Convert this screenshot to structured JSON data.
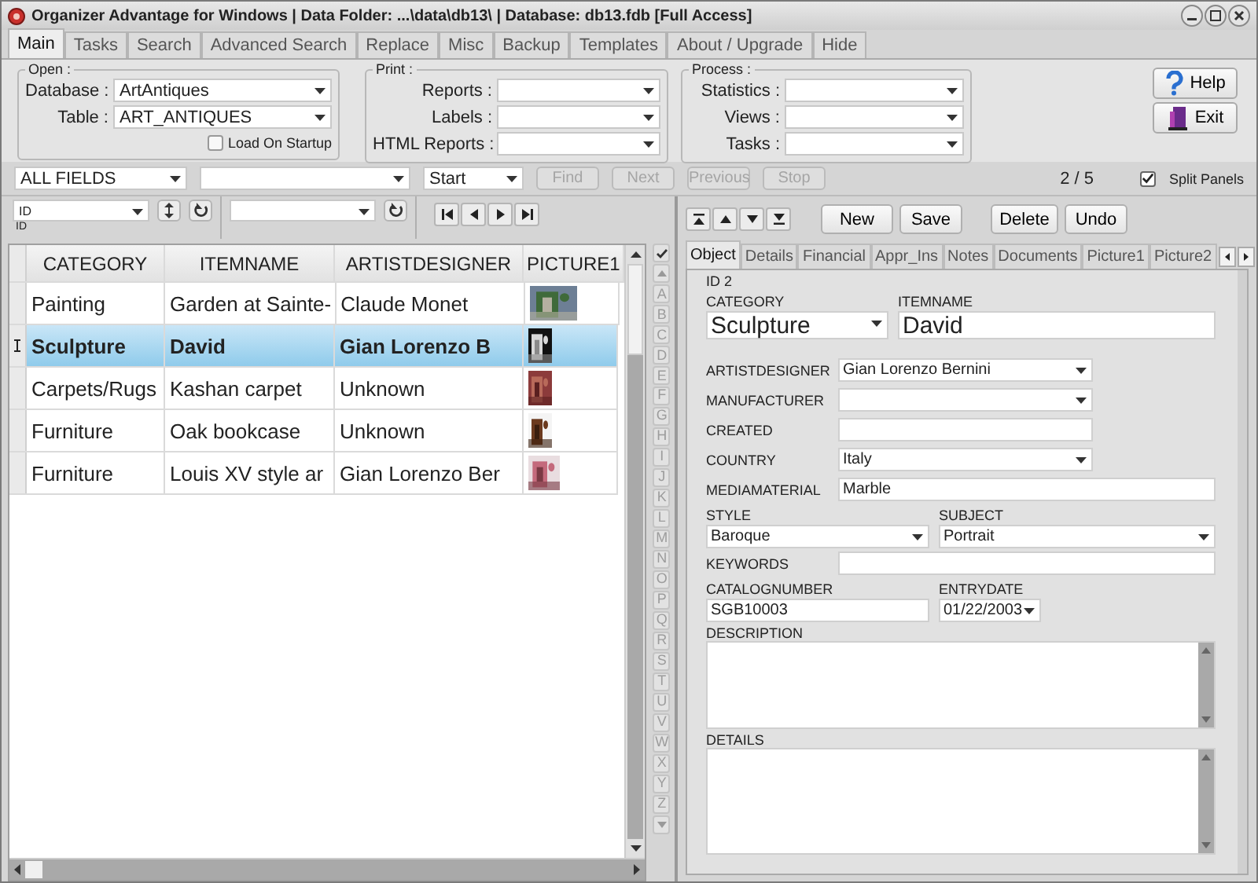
{
  "window": {
    "title": "Organizer Advantage for Windows | Data Folder: ...\\data\\db13\\ | Database: db13.fdb [Full Access]"
  },
  "tabs": [
    {
      "label": "Main",
      "selected": true
    },
    {
      "label": "Tasks",
      "selected": false
    },
    {
      "label": "Search",
      "selected": false
    },
    {
      "label": "Advanced Search",
      "selected": false
    },
    {
      "label": "Replace",
      "selected": false
    },
    {
      "label": "Misc",
      "selected": false
    },
    {
      "label": "Backup",
      "selected": false
    },
    {
      "label": "Templates",
      "selected": false
    },
    {
      "label": "About / Upgrade",
      "selected": false
    },
    {
      "label": "Hide",
      "selected": false
    }
  ],
  "open_group": {
    "legend": "Open :",
    "fields": [
      {
        "label": "Database :",
        "value": "ArtAntiques"
      },
      {
        "label": "Table :",
        "value": "ART_ANTIQUES"
      }
    ],
    "load_on_startup": {
      "label": "Load On Startup",
      "checked": false
    }
  },
  "print_group": {
    "legend": "Print :",
    "fields": [
      {
        "label": "Reports :"
      },
      {
        "label": "Labels :"
      },
      {
        "label": "HTML Reports :"
      }
    ]
  },
  "process_group": {
    "legend": "Process :",
    "fields": [
      {
        "label": "Statistics :"
      },
      {
        "label": "Views :"
      },
      {
        "label": "Tasks :"
      }
    ]
  },
  "side_buttons": [
    {
      "label": "Help",
      "kind": "help"
    },
    {
      "label": "Exit",
      "kind": "exit"
    }
  ],
  "search_bar": {
    "field": "ALL FIELDS",
    "position": "Start",
    "buttons": [
      {
        "label": "Find",
        "disabled": true
      },
      {
        "label": "Next",
        "disabled": true
      },
      {
        "label": "Previous",
        "disabled": true
      },
      {
        "label": "Stop",
        "disabled": true
      }
    ],
    "counter": "2 / 5",
    "split_panels": {
      "label": "Split Panels",
      "checked": true
    }
  },
  "list_toolbar": {
    "sort_field": "ID",
    "sort_caption": "ID"
  },
  "grid": {
    "columns": [
      "CATEGORY",
      "ITEMNAME",
      "ARTISTDESIGNER",
      "PICTURE1"
    ],
    "rows": [
      {
        "cells": [
          "Painting",
          "Garden at Sainte-",
          "Claude Monet"
        ],
        "selected": false
      },
      {
        "cells": [
          "Sculpture",
          "David",
          "Gian Lorenzo B"
        ],
        "selected": true
      },
      {
        "cells": [
          "Carpets/Rugs",
          "Kashan carpet",
          "Unknown"
        ],
        "selected": false
      },
      {
        "cells": [
          "Furniture",
          "Oak bookcase",
          "Unknown"
        ],
        "selected": false
      },
      {
        "cells": [
          "Furniture",
          "Louis XV style ar",
          "Gian Lorenzo Ber"
        ],
        "selected": false
      }
    ]
  },
  "alphabet": [
    "A",
    "B",
    "C",
    "D",
    "E",
    "F",
    "G",
    "H",
    "I",
    "J",
    "K",
    "L",
    "M",
    "N",
    "O",
    "P",
    "Q",
    "R",
    "S",
    "T",
    "U",
    "V",
    "W",
    "X",
    "Y",
    "Z"
  ],
  "record_buttons": [
    "New",
    "Save",
    "Delete",
    "Undo"
  ],
  "record_tabs": [
    {
      "label": "Object",
      "selected": true
    },
    {
      "label": "Details",
      "selected": false
    },
    {
      "label": "Financial",
      "selected": false
    },
    {
      "label": "Appr_Ins",
      "selected": false
    },
    {
      "label": "Notes",
      "selected": false
    },
    {
      "label": "Documents",
      "selected": false
    },
    {
      "label": "Picture1",
      "selected": false
    },
    {
      "label": "Picture2",
      "selected": false
    }
  ],
  "form": {
    "id": "ID 2",
    "rows": [
      {
        "kind": "pair",
        "large": true,
        "fields": [
          {
            "kind": "combo",
            "label": "CATEGORY",
            "value": "Sculpture"
          },
          {
            "kind": "text",
            "label": "ITEMNAME",
            "value": "David"
          }
        ]
      },
      {
        "kind": "line",
        "field": {
          "kind": "combo",
          "label": "ARTISTDESIGNER",
          "value": "Gian Lorenzo Bernini"
        }
      },
      {
        "kind": "line",
        "field": {
          "kind": "combo",
          "label": "MANUFACTURER"
        }
      },
      {
        "kind": "line",
        "field": {
          "kind": "short",
          "label": "CREATED"
        }
      },
      {
        "kind": "line",
        "field": {
          "kind": "combo",
          "label": "COUNTRY",
          "value": "Italy"
        }
      },
      {
        "kind": "line",
        "field": {
          "kind": "text",
          "label": "MEDIAMATERIAL",
          "value": "Marble"
        }
      },
      {
        "kind": "pair",
        "fields": [
          {
            "kind": "combo",
            "label": "STYLE",
            "value": "Baroque"
          },
          {
            "kind": "combo",
            "label": "SUBJECT",
            "value": "Portrait"
          }
        ]
      },
      {
        "kind": "line",
        "field": {
          "kind": "text",
          "label": "KEYWORDS"
        }
      },
      {
        "kind": "pair",
        "fields": [
          {
            "kind": "text",
            "label": "CATALOGNUMBER",
            "value": "SGB10003"
          },
          {
            "kind": "date",
            "label": "ENTRYDATE",
            "value": "01/22/2003"
          }
        ]
      },
      {
        "kind": "memo",
        "label": "DESCRIPTION",
        "tall": false
      },
      {
        "kind": "memo",
        "label": "DETAILS",
        "tall": true
      }
    ]
  }
}
